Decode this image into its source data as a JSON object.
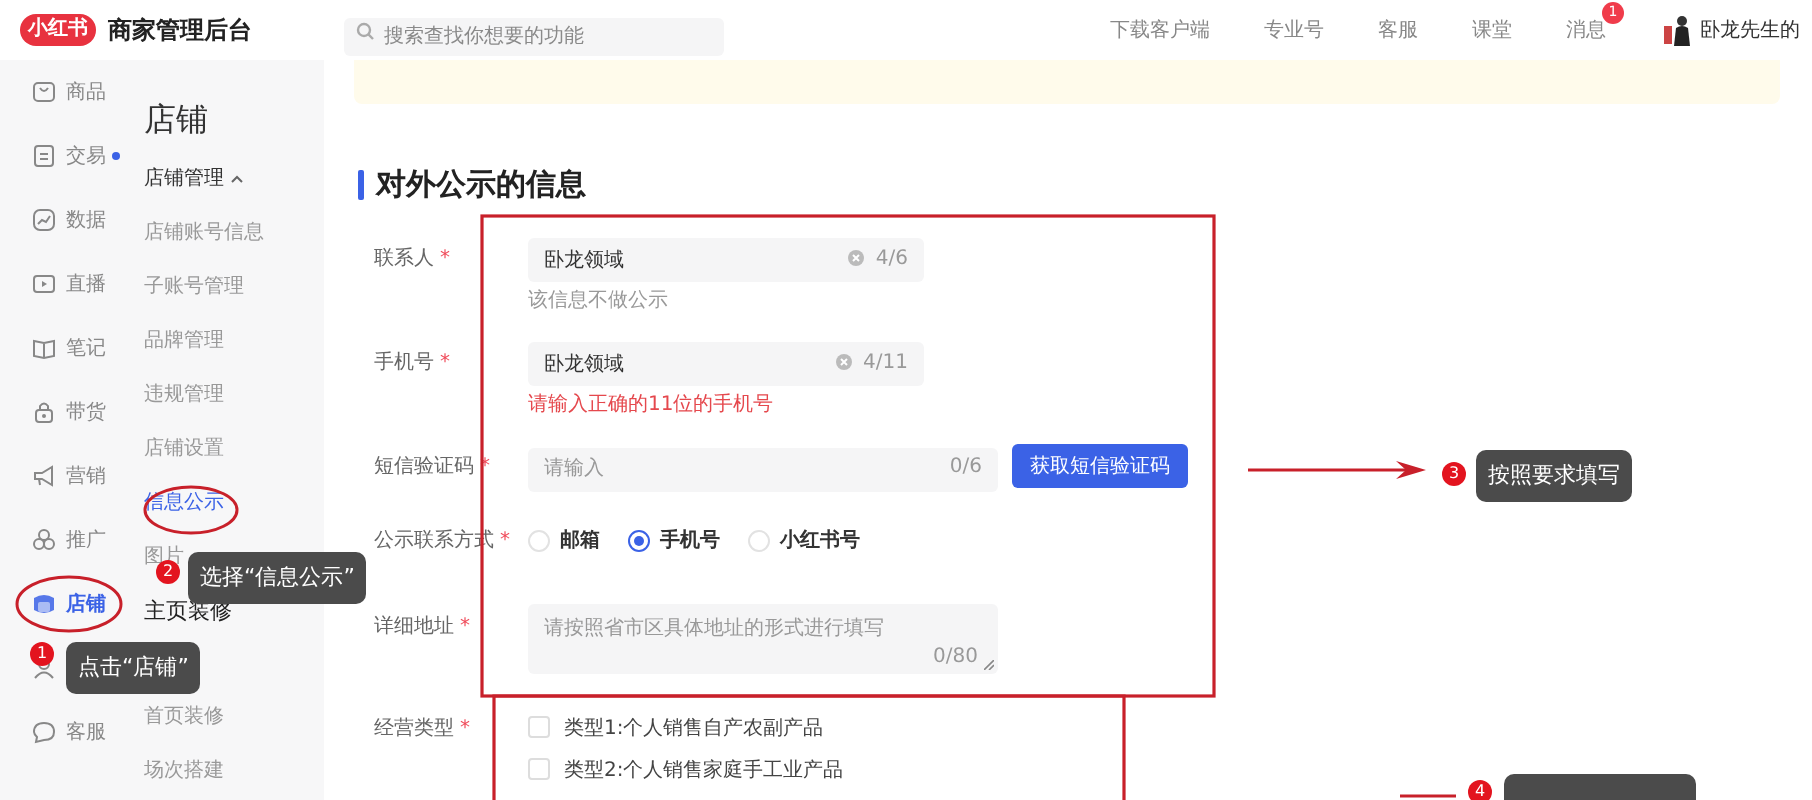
{
  "header": {
    "logo": "小红书",
    "title": "商家管理后台",
    "search": {
      "placeholder": "搜索查找你想要的功能"
    },
    "nav": [
      {
        "label": "下载客户端"
      },
      {
        "label": "专业号"
      },
      {
        "label": "客服"
      },
      {
        "label": "课堂"
      },
      {
        "label": "消息",
        "badge": "1"
      }
    ],
    "user": "卧龙先生的"
  },
  "sidebar": {
    "items": [
      {
        "label": "商品",
        "selected": false
      },
      {
        "label": "交易",
        "selected": false,
        "dot": true
      },
      {
        "label": "数据",
        "selected": false
      },
      {
        "label": "直播",
        "selected": false
      },
      {
        "label": "笔记",
        "selected": false
      },
      {
        "label": "带货",
        "selected": false
      },
      {
        "label": "营销",
        "selected": false
      },
      {
        "label": "推广",
        "selected": false
      },
      {
        "label": "店铺",
        "selected": true
      },
      {
        "selected": false
      },
      {
        "label": "客服",
        "selected": false
      }
    ]
  },
  "subnav": {
    "title": "店铺",
    "items": [
      {
        "kind": "group",
        "label": "店铺管理",
        "expanded": true
      },
      {
        "kind": "link",
        "label": "店铺账号信息",
        "selected": false
      },
      {
        "kind": "link",
        "label": "子账号管理",
        "selected": false
      },
      {
        "kind": "link",
        "label": "品牌管理",
        "selected": false
      },
      {
        "kind": "link",
        "label": "违规管理",
        "selected": false
      },
      {
        "kind": "link",
        "label": "店铺设置",
        "selected": false
      },
      {
        "kind": "link",
        "label": "信息公示",
        "selected": true
      },
      {
        "kind": "link",
        "label": "图片",
        "selected": false
      },
      {
        "kind": "group",
        "label": "主页装修"
      },
      {
        "kind": "link",
        "selected": false
      },
      {
        "kind": "link",
        "label": "首页装修",
        "selected": false
      },
      {
        "kind": "link",
        "label": "场次搭建",
        "selected": false
      }
    ]
  },
  "form": {
    "title": "对外公示的信息",
    "fields": [
      {
        "kind": "text",
        "label": "联系人",
        "required_mark": "*",
        "value": "卧龙领域",
        "clearable": true,
        "counter": "4/6",
        "hint": "该信息不做公示"
      },
      {
        "kind": "text",
        "label": "手机号",
        "required_mark": "*",
        "value": "卧龙领域",
        "clearable": true,
        "counter": "4/11",
        "error": "请输入正确的11位的手机号"
      },
      {
        "kind": "text",
        "label": "短信验证码",
        "required_mark": "*",
        "placeholder": "请输入",
        "counter": "0/6",
        "button": "获取短信验证码"
      },
      {
        "kind": "radio",
        "label": "公示联系方式",
        "required_mark": "*",
        "options": [
          {
            "label": "邮箱",
            "selected": false
          },
          {
            "label": "手机号",
            "selected": true
          },
          {
            "label": "小红书号",
            "selected": false
          }
        ]
      },
      {
        "kind": "textarea",
        "label": "详细地址",
        "required_mark": "*",
        "placeholder": "请按照省市区具体地址的形式进行填写",
        "counter": "0/80"
      },
      {
        "kind": "checkbox",
        "label": "经营类型",
        "required_mark": "*",
        "options": [
          {
            "label": "类型1:个人销售自产农副产品",
            "checked": false
          },
          {
            "label": "类型2:个人销售家庭手工业产品",
            "checked": false
          }
        ]
      }
    ]
  },
  "annotations": [
    {
      "number": "1",
      "text": "点击“店铺”"
    },
    {
      "number": "2",
      "text": "选择“信息公示”"
    },
    {
      "number": "3",
      "text": "按照要求填写"
    },
    {
      "number": "4"
    }
  ]
}
